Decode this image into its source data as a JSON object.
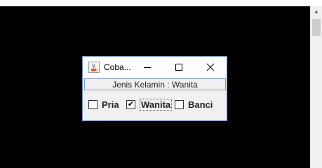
{
  "window": {
    "title": "Coba...",
    "app_icon": "java-cup-icon",
    "controls": {
      "minimize": "minimize-icon",
      "maximize": "maximize-icon",
      "close": "close-icon"
    }
  },
  "label": {
    "text": "Jenis Kelamin : Wanita"
  },
  "options": [
    {
      "label": "Pria",
      "checked": false
    },
    {
      "label": "Wanita",
      "checked": true,
      "focused": true
    },
    {
      "label": "Banci",
      "checked": false
    }
  ],
  "colors": {
    "desktop": "#000000",
    "window_bg": "#f0f0f0",
    "window_border": "#6d8fbf",
    "label_border": "#7a9cc6"
  },
  "checkmark": "✔"
}
